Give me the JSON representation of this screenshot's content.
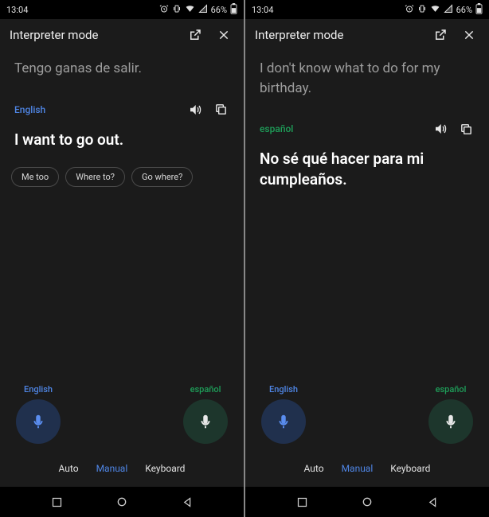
{
  "status": {
    "time": "13:04",
    "battery_percent": "66%"
  },
  "header": {
    "title": "Interpreter mode"
  },
  "panes": [
    {
      "source_text": "Tengo ganas de salir.",
      "target_lang_label": "English",
      "target_lang_class": "english",
      "target_text": "I want to go out.",
      "suggestions": [
        "Me too",
        "Where to?",
        "Go where?"
      ],
      "mic_left": {
        "label": "English",
        "lang_class": "english",
        "style": "blue"
      },
      "mic_right": {
        "label": "español",
        "lang_class": "spanish",
        "style": "green"
      }
    },
    {
      "source_text": "I don't know what to do for my birthday.",
      "target_lang_label": "español",
      "target_lang_class": "spanish",
      "target_text": "No sé qué hacer para mi cumpleaños.",
      "suggestions": [],
      "mic_left": {
        "label": "English",
        "lang_class": "english",
        "style": "blue"
      },
      "mic_right": {
        "label": "español",
        "lang_class": "spanish",
        "style": "green"
      }
    }
  ],
  "modes": {
    "auto": "Auto",
    "manual": "Manual",
    "keyboard": "Keyboard",
    "active": "manual"
  }
}
